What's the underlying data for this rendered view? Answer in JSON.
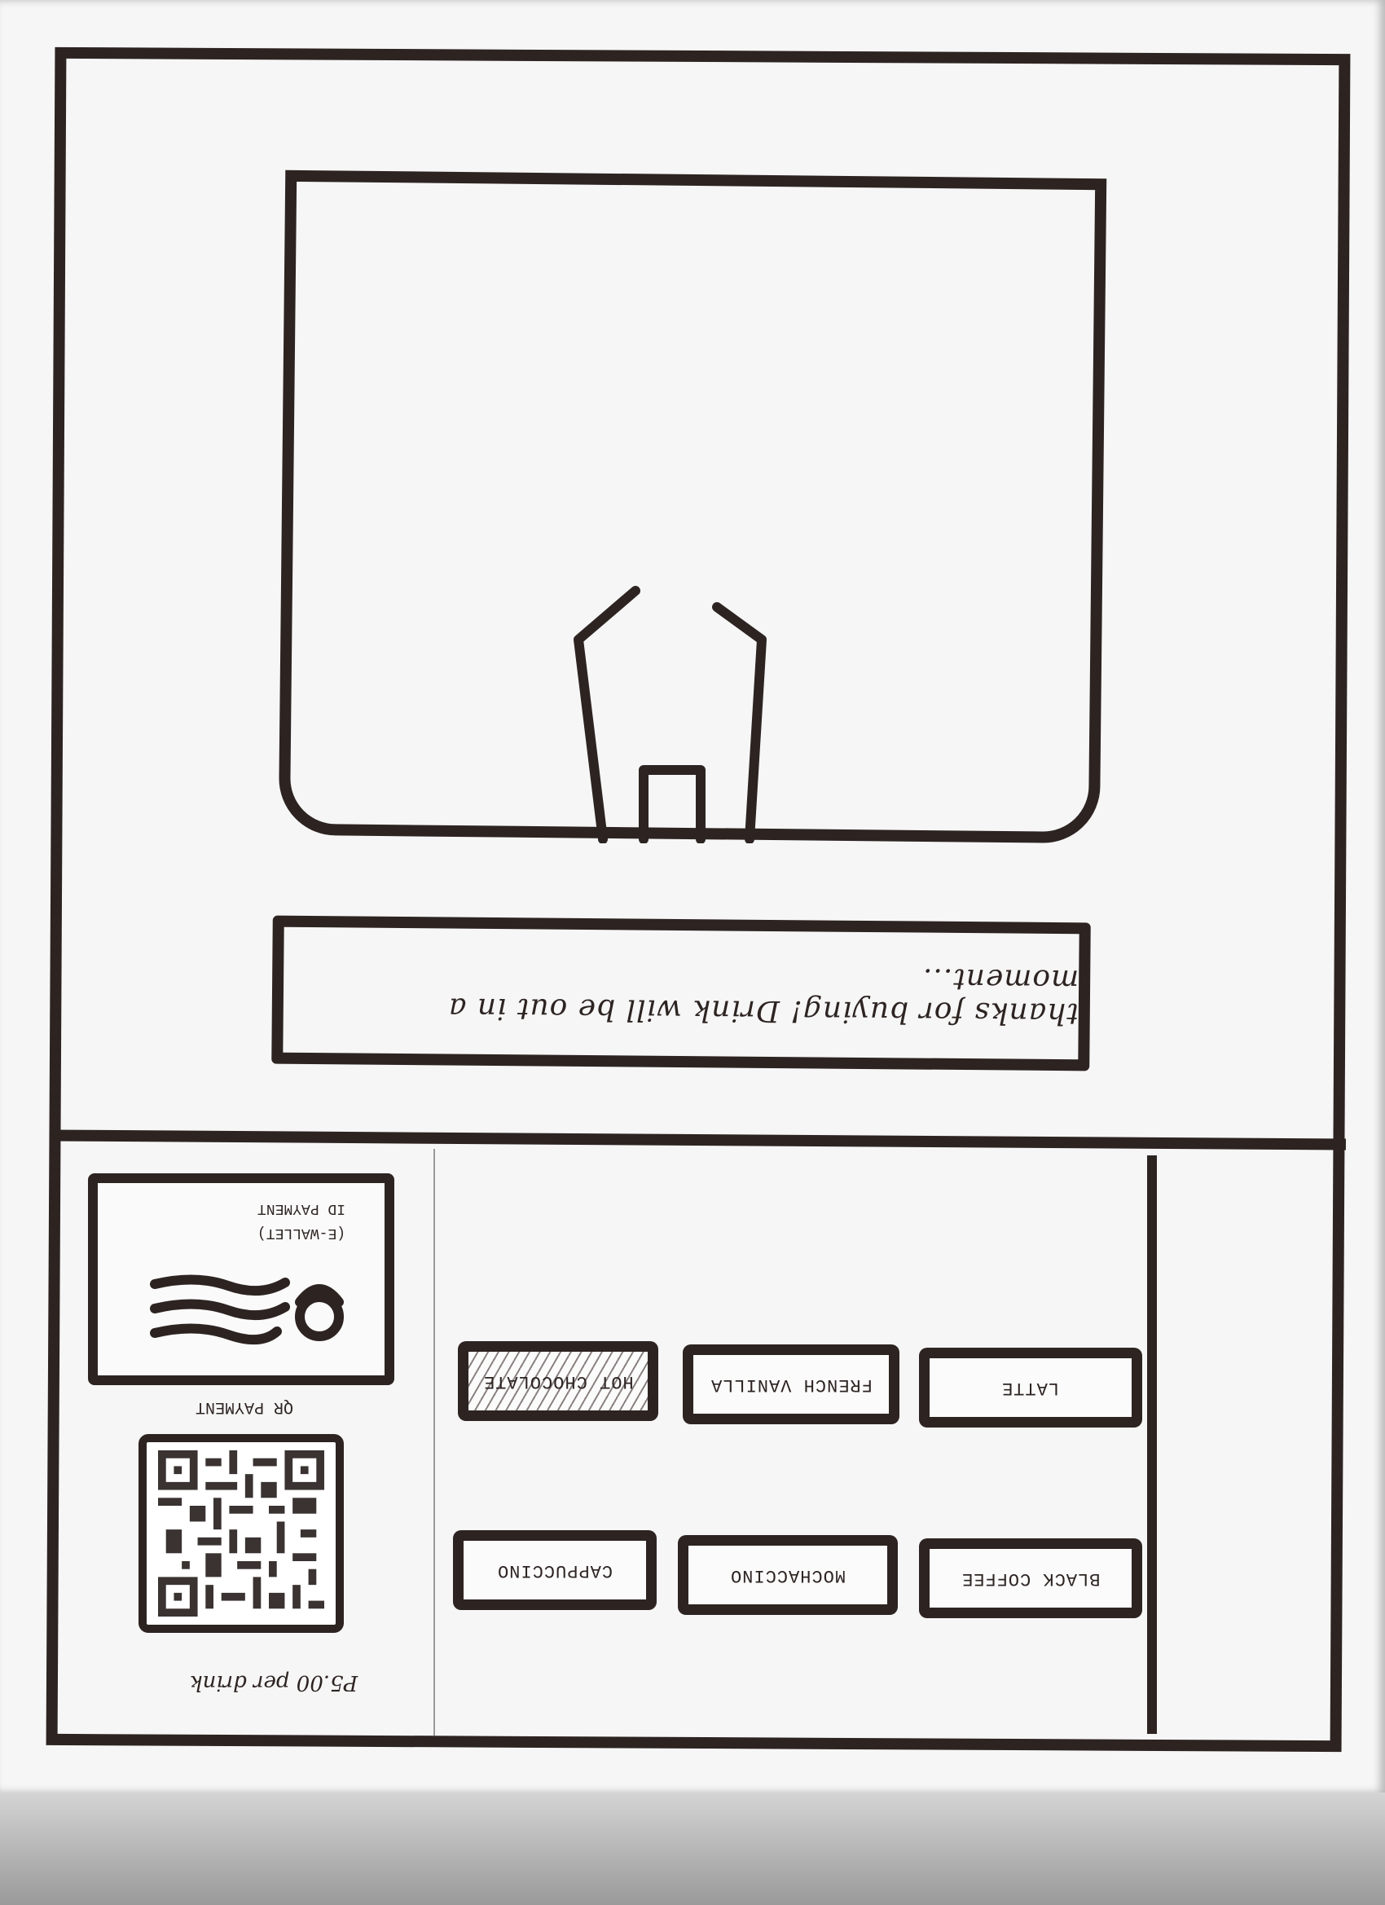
{
  "status": {
    "message": "thanks for buying! Drink will be out in a moment..."
  },
  "menu": {
    "drinks": [
      {
        "label": "LATTE",
        "selected": false
      },
      {
        "label": "FRENCH VANILLA",
        "selected": false
      },
      {
        "label": "HOT CHOCOLATE",
        "selected": true
      },
      {
        "label": "BLACK COFFEE",
        "selected": false
      },
      {
        "label": "MOCHACCINO",
        "selected": false
      },
      {
        "label": "CAPPUCCINO",
        "selected": false
      }
    ]
  },
  "payment": {
    "price": "P5.00 per drink",
    "qr_label": "QR PAYMENT",
    "ewallet_line1": "(E-WALLET)",
    "ewallet_line2": "ID PAYMENT"
  },
  "icons": {
    "dispenser": "cup-dispenser-icon",
    "qr": "qr-code-icon",
    "id_card": "id-card-icon"
  },
  "colors": {
    "ink": "#2d2422",
    "paper": "#f6f6f6"
  }
}
